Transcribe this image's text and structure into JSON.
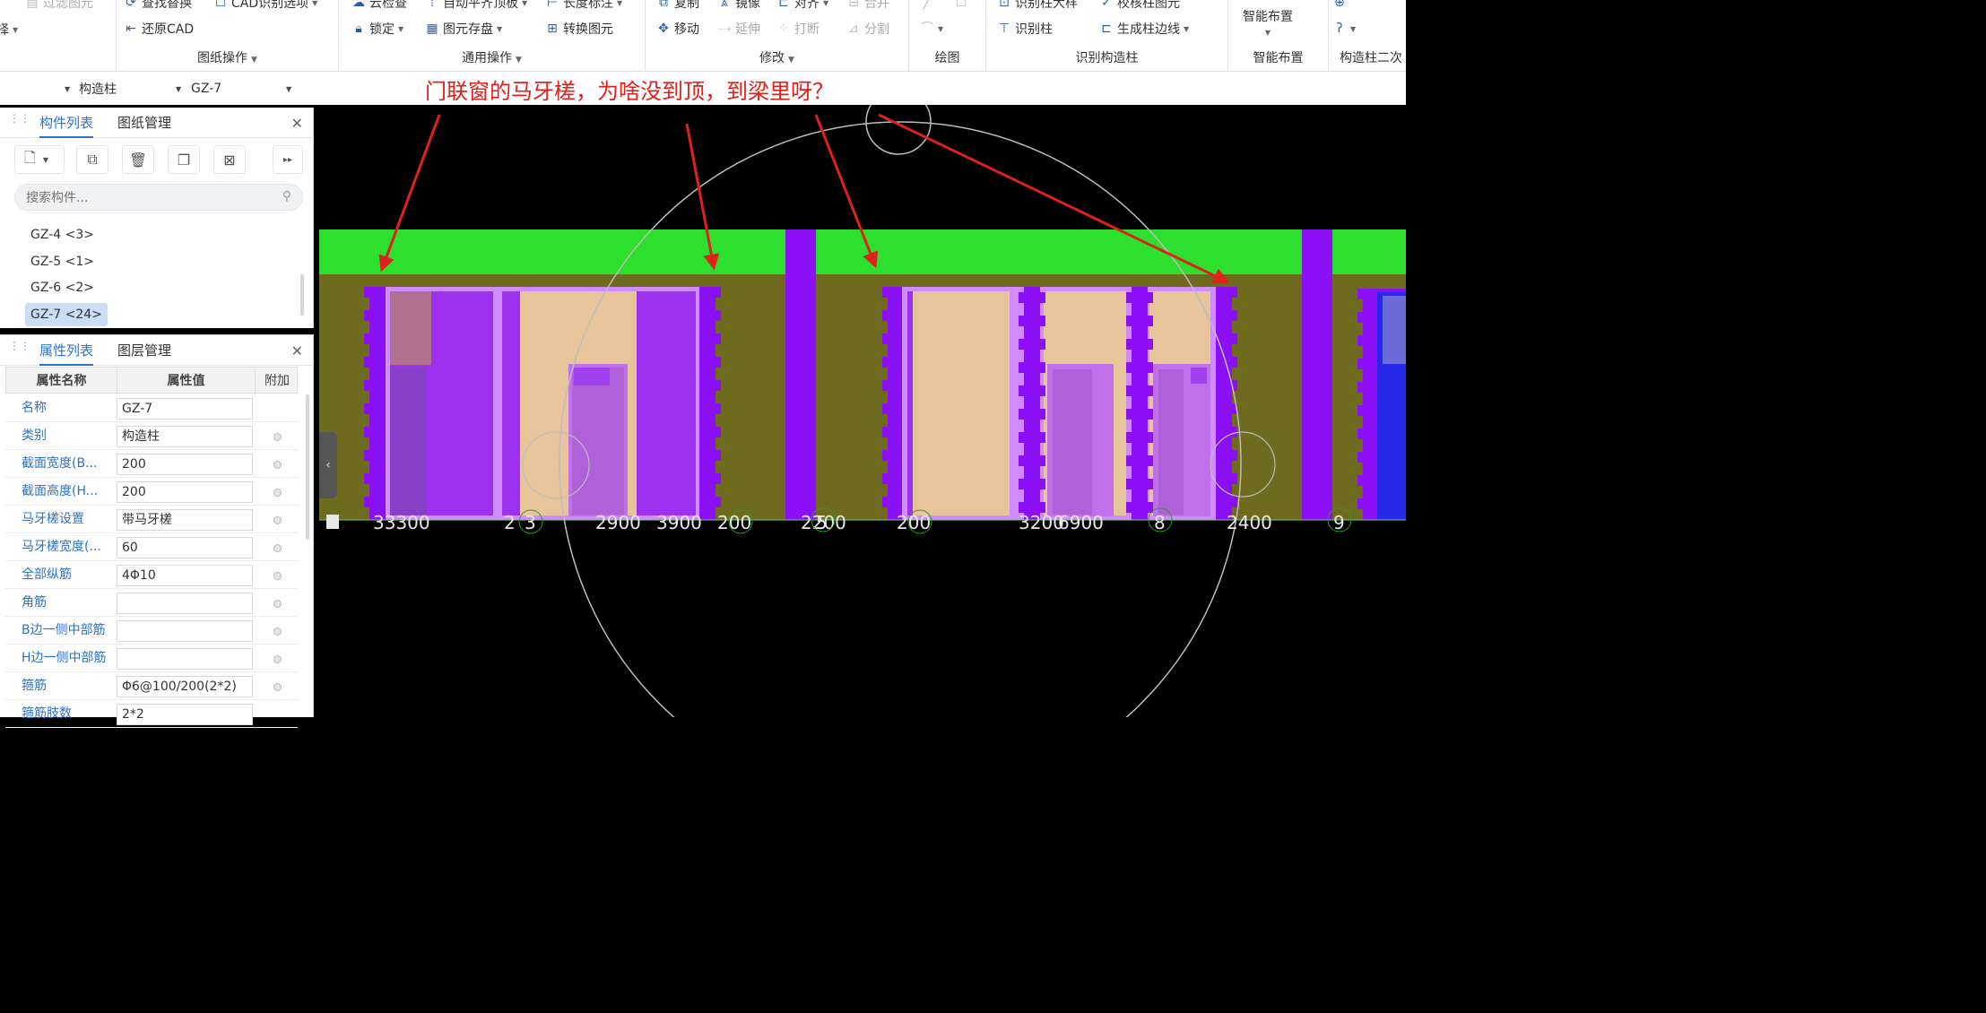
{
  "ribbon": {
    "groups": {
      "drawing_ops": "图纸操作",
      "general_ops": "通用操作",
      "modify": "修改",
      "draw": "绘图",
      "identify_column": "识别构造柱",
      "smart_layout": "智能布置",
      "column_secondary": "构造柱二次"
    },
    "buttons": {
      "filter": "过滤图元",
      "find_replace": "查找替换",
      "cad_options": "CAD识别选项",
      "restore_cad": "还原CAD",
      "cloud_check": "云检查",
      "auto_flush": "自动平齐顶板",
      "length_mark": "长度标注",
      "lock": "锁定",
      "store": "图元存盘",
      "convert": "转换图元",
      "copy": "复制",
      "mirror": "镜像",
      "align": "对齐",
      "merge": "合并",
      "move": "移动",
      "extend": "延伸",
      "break": "打断",
      "split": "分割",
      "column_table": "识别柱大样",
      "check_column": "校核柱图元",
      "identify_col": "识别柱",
      "gen_edge": "生成柱边线",
      "smart": "智能布置"
    }
  },
  "selector": {
    "type": "构造柱",
    "name": "GZ-7"
  },
  "annotation": "门联窗的马牙槎，为啥没到顶，到梁里呀？",
  "component_panel": {
    "tabs": [
      "构件列表",
      "图纸管理"
    ],
    "search_placeholder": "搜索构件...",
    "items": [
      "GZ-4 <3>",
      "GZ-5 <1>",
      "GZ-6 <2>",
      "GZ-7 <24>"
    ]
  },
  "property_panel": {
    "tabs": [
      "属性列表",
      "图层管理"
    ],
    "headers": [
      "属性名称",
      "属性值",
      "附加"
    ],
    "rows": [
      {
        "name": "名称",
        "value": "GZ-7"
      },
      {
        "name": "类别",
        "value": "构造柱"
      },
      {
        "name": "截面宽度(B...",
        "value": "200"
      },
      {
        "name": "截面高度(H...",
        "value": "200"
      },
      {
        "name": "马牙槎设置",
        "value": "带马牙槎"
      },
      {
        "name": "马牙槎宽度(...",
        "value": "60"
      },
      {
        "name": "全部纵筋",
        "value": "4Φ10"
      },
      {
        "name": "角筋",
        "value": ""
      },
      {
        "name": "B边一侧中部筋",
        "value": ""
      },
      {
        "name": "H边一侧中部筋",
        "value": ""
      },
      {
        "name": "箍筋",
        "value": "Φ6@100/200(2*2)"
      },
      {
        "name": "箍筋肢数",
        "value": "2*2"
      }
    ]
  },
  "cad_labels": [
    "33300",
    "2",
    "3",
    "2900",
    "3900",
    "200",
    "2200",
    "5",
    "200",
    "3200",
    "6900",
    "8",
    "2400",
    "9"
  ],
  "colors": {
    "beam": "#2ee02e",
    "wall": "#6e6a1e",
    "column": "#8b10f5",
    "opening": "#e8c49a",
    "annotation": "#e0201a",
    "accent": "#2d72c8"
  }
}
